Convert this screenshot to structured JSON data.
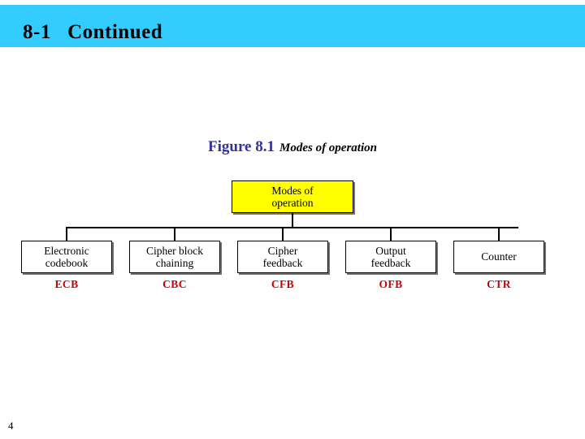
{
  "slide": {
    "title": "8-1   Continued",
    "number": "4",
    "banner_color": "#33ccff"
  },
  "figure": {
    "label": "Figure 8.1",
    "title": "Modes of operation",
    "label_color": "#333399"
  },
  "chart_data": {
    "type": "diagram",
    "title": "Modes of operation",
    "root": {
      "label": "Modes of\noperation",
      "fill": "#ffff00"
    },
    "children": [
      {
        "label": "Electronic\ncodebook",
        "abbr": "ECB"
      },
      {
        "label": "Cipher block\nchaining",
        "abbr": "CBC"
      },
      {
        "label": "Cipher\nfeedback",
        "abbr": "CFB"
      },
      {
        "label": "Output\nfeedback",
        "abbr": "OFB"
      },
      {
        "label": "Counter",
        "abbr": "CTR"
      }
    ],
    "abbr_color": "#cc0000"
  }
}
